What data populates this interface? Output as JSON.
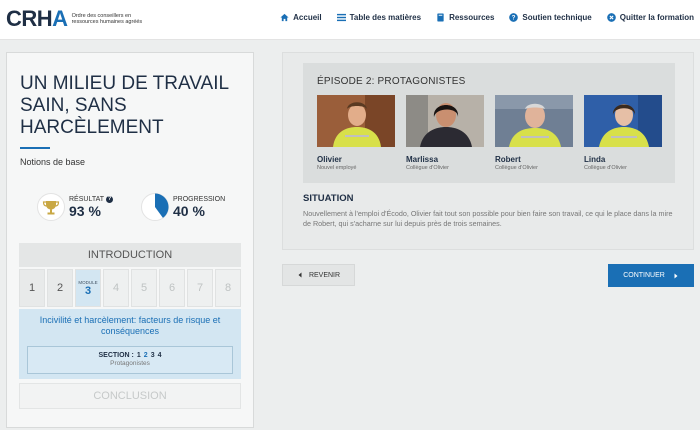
{
  "brand": {
    "logo": "CRHA",
    "subtitle": "Ordre des conseillers en ressources humaines agréés",
    "accent": "#1a6fb5",
    "dark": "#1f2f45"
  },
  "nav": [
    {
      "label": "Accueil",
      "icon": "home-icon"
    },
    {
      "label": "Table des matières",
      "icon": "list-icon"
    },
    {
      "label": "Ressources",
      "icon": "book-icon"
    },
    {
      "label": "Soutien technique",
      "icon": "help-icon"
    },
    {
      "label": "Quitter la formation",
      "icon": "close-circle-icon"
    }
  ],
  "course": {
    "title": "UN MILIEU DE TRAVAIL SAIN, SANS HARCÈLEMENT",
    "subtitle": "Notions de base"
  },
  "stats": {
    "result_label": "RÉSULTAT",
    "result_value": "93 %",
    "progress_label": "PROGRESSION",
    "progress_value": "40 %",
    "progress_fraction": 0.4
  },
  "outline": {
    "intro": "INTRODUCTION",
    "modules": [
      "1",
      "2",
      "3",
      "4",
      "5",
      "6",
      "7",
      "8"
    ],
    "active_module_label": "MODULE",
    "active_module_index": 2,
    "module_title": "Incivilité et harcèlement: facteurs de risque et conséquences",
    "section_label": "SECTION :",
    "sections": [
      "1",
      "2",
      "3",
      "4"
    ],
    "current_section_index": 1,
    "section_name": "Protagonistes",
    "conclusion": "CONCLUSION"
  },
  "episode": {
    "title": "ÉPISODE 2: PROTAGONISTES",
    "characters": [
      {
        "name": "Olivier",
        "role": "Nouvel employé"
      },
      {
        "name": "Marlissa",
        "role": "Collègue d'Olivier"
      },
      {
        "name": "Robert",
        "role": "Collègue d'Olivier"
      },
      {
        "name": "Linda",
        "role": "Collègue d'Olivier"
      }
    ]
  },
  "situation": {
    "title": "SITUATION",
    "text": "Nouvellement à l'emploi d'Écodo, Olivier fait tout son possible pour bien faire son travail, ce qui le place dans la mire de Robert, qui s'acharne sur lui depuis près de trois semaines."
  },
  "buttons": {
    "back": "REVENIR",
    "continue": "CONTINUER"
  }
}
